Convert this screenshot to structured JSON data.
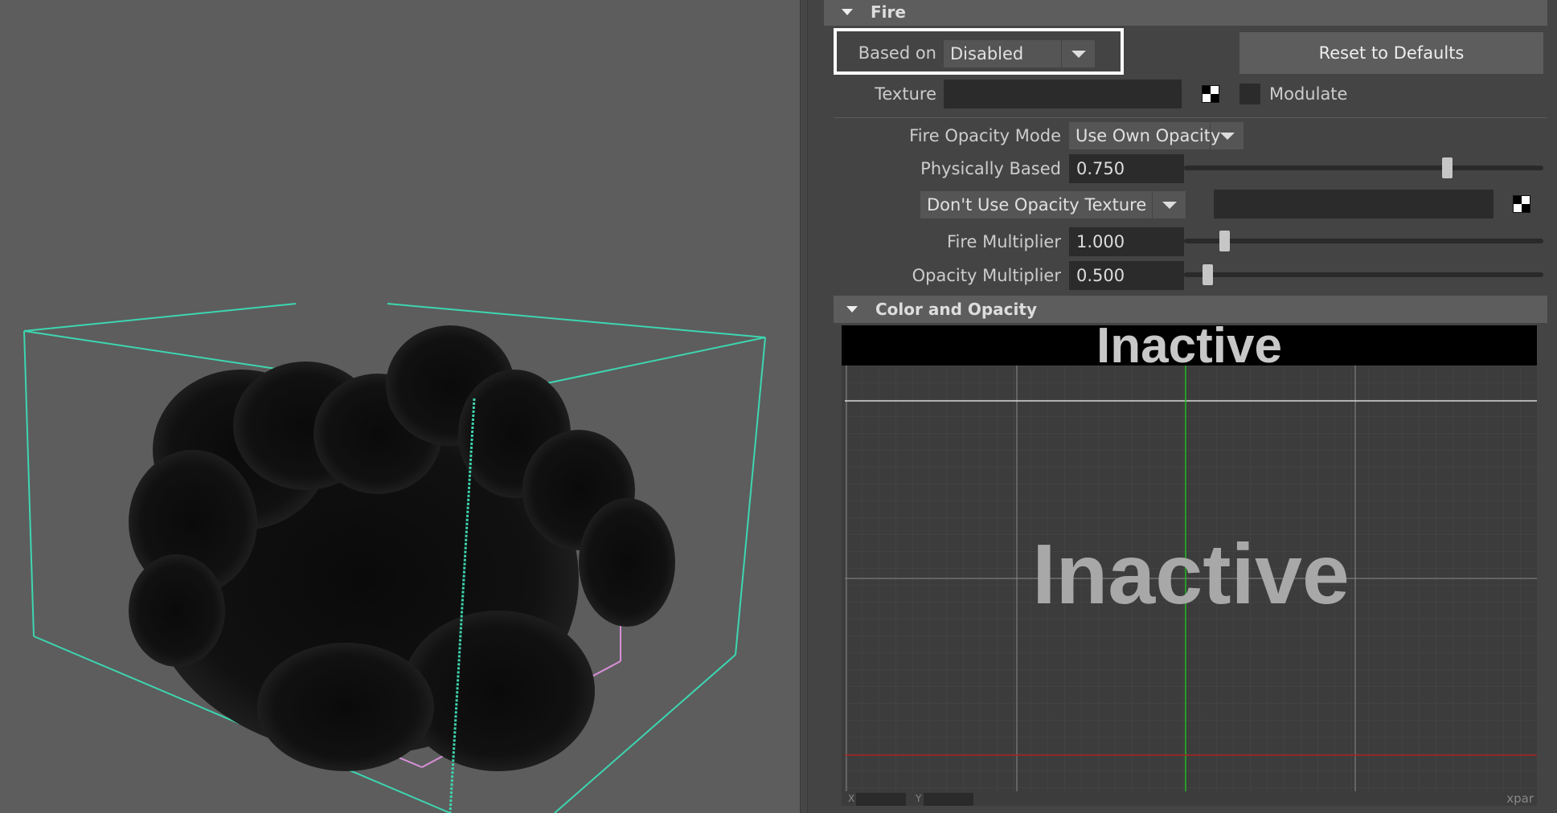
{
  "fire": {
    "section_title": "Fire",
    "based_on_label": "Based on",
    "based_on_value": "Disabled",
    "reset_button": "Reset to Defaults",
    "texture_label": "Texture",
    "texture_value": "",
    "modulate_label": "Modulate",
    "modulate_checked": false,
    "fire_opacity_mode_label": "Fire Opacity Mode",
    "fire_opacity_mode_value": "Use Own Opacity",
    "physically_based_label": "Physically Based",
    "physically_based_value": "0.750",
    "physically_based_fraction": 0.75,
    "opacity_texture_value": "Don't Use Opacity Texture",
    "opacity_texture_field": "",
    "fire_multiplier_label": "Fire Multiplier",
    "fire_multiplier_value": "1.000",
    "fire_multiplier_fraction": 0.1,
    "opacity_multiplier_label": "Opacity Multiplier",
    "opacity_multiplier_value": "0.500",
    "opacity_multiplier_fraction": 0.05
  },
  "color_opacity": {
    "section_title": "Color and Opacity",
    "inactive_banner": "Inactive",
    "graph_inactive": "Inactive",
    "x_label": "X",
    "y_label": "Y",
    "corner_text": "xpar"
  },
  "colors": {
    "bbox_wire": "#3dd6b0",
    "inner_wire": "#d890d8",
    "green_axis": "#22bb22",
    "red_line": "#aa2222",
    "highlight": "#ffffff"
  }
}
